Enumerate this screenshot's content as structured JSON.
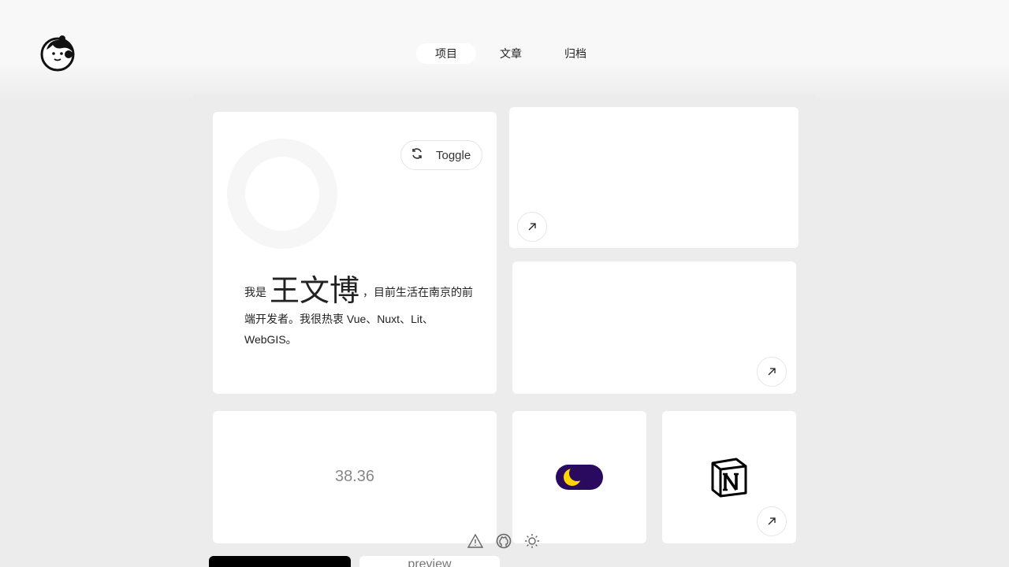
{
  "nav": {
    "items": [
      "项目",
      "文章",
      "归档"
    ],
    "active_index": 0
  },
  "profile": {
    "toggle_label": "Toggle",
    "intro_prefix": "我是",
    "name": "王文博",
    "intro_suffix": "，目前生活在南京的前端开发者。我很热衷 Vue、Nuxt、Lit、WebGIS。"
  },
  "stat_card": {
    "value": "38.36"
  },
  "theme_toggle": {
    "mode": "dark",
    "track_color": "#2a0a5e",
    "moon_color": "#ffd400"
  },
  "footer": {
    "icons": [
      "warning-triangle-icon",
      "github-icon",
      "sun-icon"
    ]
  },
  "bottom_preview": {
    "label": "preview"
  }
}
